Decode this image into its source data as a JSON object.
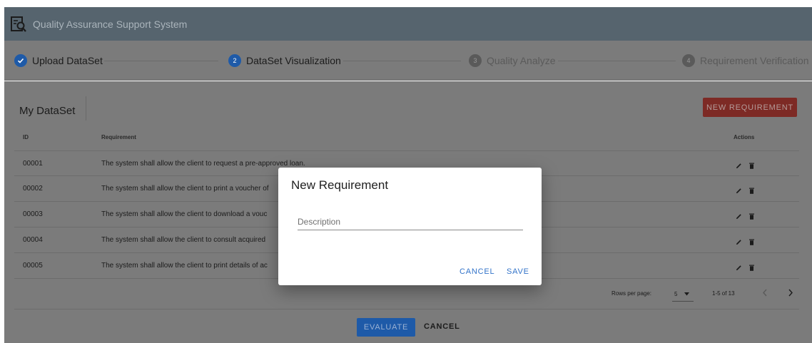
{
  "app": {
    "title": "Quality Assurance Support System",
    "logo_icon": "document-search-icon"
  },
  "stepper": {
    "steps": [
      {
        "label": "Upload DataSet",
        "number": "1",
        "state": "completed"
      },
      {
        "label": "DataSet Visualization",
        "number": "2",
        "state": "active"
      },
      {
        "label": "Quality Analyze",
        "number": "3",
        "state": "pending"
      },
      {
        "label": "Requirement Verification",
        "number": "4",
        "state": "pending"
      }
    ]
  },
  "dataset": {
    "title": "My DataSet",
    "new_button": "NEW REQUIREMENT",
    "columns": {
      "id": "ID",
      "requirement": "Requirement",
      "actions": "Actions"
    },
    "rows": [
      {
        "id": "00001",
        "requirement": "The system shall allow the client to request a pre-approved loan."
      },
      {
        "id": "00002",
        "requirement": "The system shall allow the client to print a voucher of"
      },
      {
        "id": "00003",
        "requirement": "The system shall allow the client to download a vouc"
      },
      {
        "id": "00004",
        "requirement": "The system shall allow the client to consult acquired"
      },
      {
        "id": "00005",
        "requirement": "The system shall allow the client to print details of ac"
      }
    ],
    "pagination": {
      "rows_per_page_label": "Rows per page:",
      "rows_per_page": "5",
      "range": "1-5 of 13"
    }
  },
  "footer": {
    "evaluate": "EVALUATE",
    "cancel": "CANCEL"
  },
  "dialog": {
    "title": "New Requirement",
    "field_label": "Description",
    "field_value": "",
    "cancel": "CANCEL",
    "save": "SAVE"
  },
  "colors": {
    "appbar": "#56646e",
    "primary": "#1e5aa8",
    "accent": "#7d2a25",
    "dialog_button": "#3273c9"
  }
}
